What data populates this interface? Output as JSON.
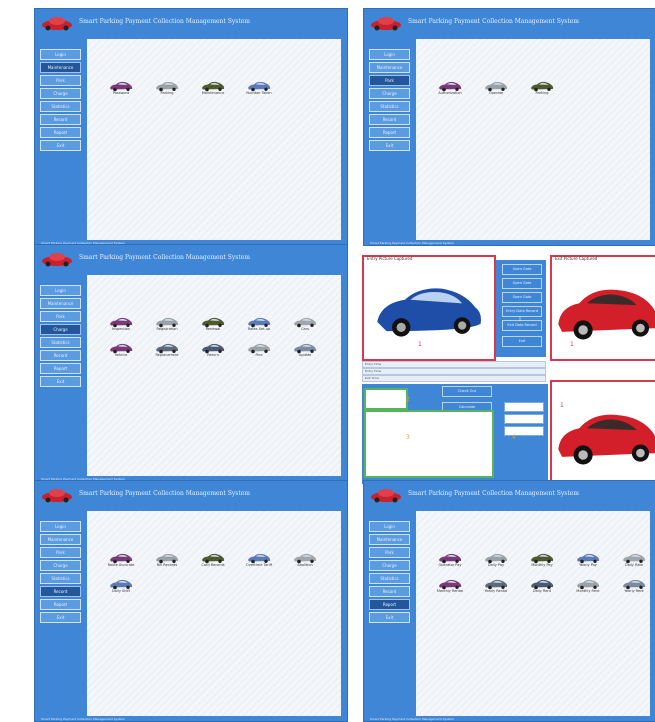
{
  "app_title": "Smart Parking Payment Collection Management System",
  "panels": [
    {
      "sidebar": [
        "Login",
        "Maintenance",
        "Park",
        "Charge",
        "Statistics",
        "Record",
        "Report",
        "Exit"
      ],
      "active_index": 1,
      "items": [
        {
          "label": "Password",
          "color": "#7a3a7a"
        },
        {
          "label": "Parking",
          "color": "#9aa2a8"
        },
        {
          "label": "Maintenance",
          "color": "#4e5a2e"
        },
        {
          "label": "Number Taken",
          "color": "#5a7ab8"
        }
      ]
    },
    {
      "sidebar": [
        "Login",
        "Maintenance",
        "Park",
        "Charge",
        "Statistics",
        "Record",
        "Report",
        "Exit"
      ],
      "active_index": 2,
      "items": [
        {
          "label": "Authorization",
          "color": "#7a3a7a"
        },
        {
          "label": "Operate",
          "color": "#9aa2a8"
        },
        {
          "label": "Parking",
          "color": "#4e5a2e"
        }
      ]
    },
    {
      "sidebar": [
        "Login",
        "Maintenance",
        "Park",
        "Charge",
        "Statistics",
        "Record",
        "Report",
        "Exit"
      ],
      "active_index": 3,
      "items": [
        {
          "label": "Inspection",
          "color": "#7a3a7a"
        },
        {
          "label": "Registration",
          "color": "#9aa2a8"
        },
        {
          "label": "Renewal",
          "color": "#4e5a2e"
        },
        {
          "label": "Rates Set-up",
          "color": "#5a7ab8"
        },
        {
          "label": "Cars",
          "color": "#a0a6ac"
        },
        {
          "label": "Vehicle",
          "color": "#7a3a7a"
        },
        {
          "label": "Replacement",
          "color": "#5c6a7a"
        },
        {
          "label": "Return",
          "color": "#4a5a72"
        },
        {
          "label": "Fine",
          "color": "#9aa2a8"
        },
        {
          "label": "Update",
          "color": "#7a8aa0"
        }
      ]
    },
    {
      "sidebar": [
        "Login",
        "Maintenance",
        "Park",
        "Charge",
        "Statistics",
        "Record",
        "Report",
        "Exit"
      ],
      "active_index": 5,
      "items": [
        {
          "label": "Route Accurate",
          "color": "#7a3a7a"
        },
        {
          "label": "Bill Records",
          "color": "#9aa2a8"
        },
        {
          "label": "Card Records",
          "color": "#4e5a2e"
        },
        {
          "label": "Overtime Tariff",
          "color": "#5a7ab8"
        },
        {
          "label": "Abolition",
          "color": "#a0a6ac"
        },
        {
          "label": "Daily Shift",
          "color": "#5a7ab8"
        }
      ]
    },
    {
      "sidebar": [
        "Login",
        "Maintenance",
        "Park",
        "Charge",
        "Statistics",
        "Record",
        "Report",
        "Exit"
      ],
      "active_index": 6,
      "items": [
        {
          "label": "Operator Pay",
          "color": "#7a3a7a"
        },
        {
          "label": "Daily Pay",
          "color": "#9aa2a8"
        },
        {
          "label": "Monthly Pay",
          "color": "#4e5a2e"
        },
        {
          "label": "Yearly Pay",
          "color": "#5a7ab8"
        },
        {
          "label": "Daily Rate",
          "color": "#a0a6ac"
        },
        {
          "label": "Monthly Rental",
          "color": "#7a3a7a"
        },
        {
          "label": "Yearly Rental",
          "color": "#5c6a7a"
        },
        {
          "label": "Daily Rent",
          "color": "#4a5a72"
        },
        {
          "label": "Monthly Rent",
          "color": "#9aa2a8"
        },
        {
          "label": "Yearly Rent",
          "color": "#7a8aa0"
        }
      ]
    }
  ],
  "footer_text": "Smart Parking Payment Collection Management System",
  "detail": {
    "left_photo_title": "Entry Picture Captured",
    "right_photo_title": "Exit Picture Captured",
    "mid_buttons": [
      "Open Gate",
      "Open Gate",
      "Open Gate",
      "Entry Data Record",
      "Exit Data Record",
      "Exit"
    ],
    "strips": [
      "Entry Time",
      "Entry Time",
      "Exit Time"
    ],
    "numbers": [
      "1",
      "1",
      "2",
      "3",
      "4",
      "1"
    ],
    "ctrl_labels": [
      "Check Out",
      "Calculate"
    ],
    "car_colors": {
      "blue": "#1f4ea8",
      "red": "#d21f2a"
    }
  }
}
